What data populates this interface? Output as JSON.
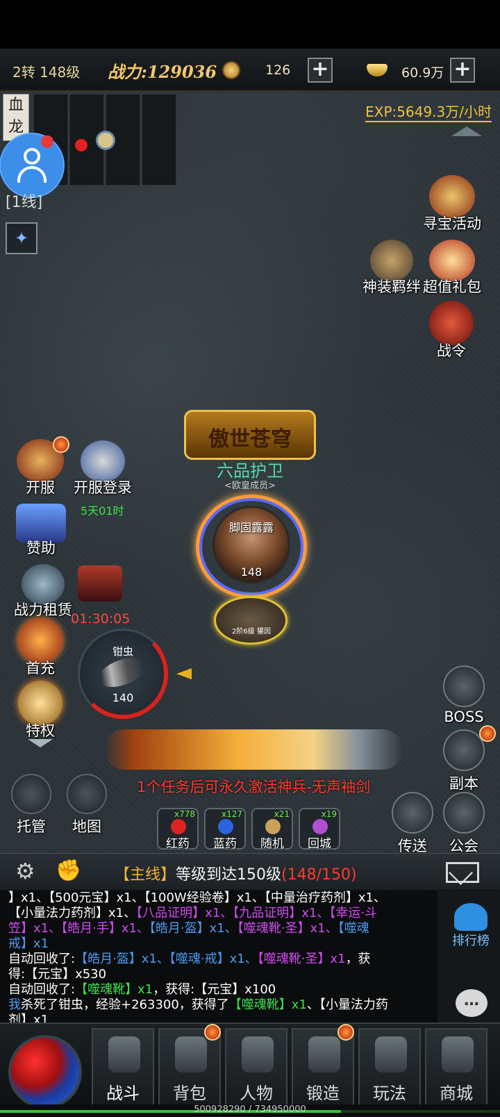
{
  "topbar": {
    "level": "2转 148级",
    "power": "战力:129036",
    "coins": "126",
    "ingots": "60.9万"
  },
  "exp_rate": "EXP:5649.3万/小时",
  "map": {
    "name": "血龙",
    "line": "[1线]"
  },
  "left_activities": [
    {
      "label": "开服"
    },
    {
      "label": "开服登录",
      "sub": "5天01时"
    },
    {
      "label": "赞助"
    },
    {
      "label": "战力租赁",
      "sub": "01:30:05"
    },
    {
      "label": "首充"
    },
    {
      "label": "特权"
    }
  ],
  "right_activities": [
    {
      "label": "寻宝活动"
    },
    {
      "label": "神装羁绊"
    },
    {
      "label": "超值礼包"
    },
    {
      "label": "战令"
    },
    {
      "label": "BOSS"
    },
    {
      "label": "副本"
    },
    {
      "label": "传送"
    },
    {
      "label": "公会"
    }
  ],
  "player": {
    "title": "傲世苍穹",
    "rank": "六品护卫",
    "guild": "<欧皇成员>",
    "name": "脚固露露",
    "level": "148",
    "pet_tag": "2阶6级 獾因"
  },
  "target": {
    "name": "钳虫",
    "level": "140",
    "hp_percent": 35
  },
  "quest_hint": {
    "prefix": "1个任务后可永久激活",
    "highlight": "神兵-无声袖剑"
  },
  "controls": {
    "auto": "托管",
    "map": "地图"
  },
  "potions": [
    {
      "label": "红药",
      "count": "x778",
      "color": "#d9241f"
    },
    {
      "label": "蓝药",
      "count": "x127",
      "color": "#2a64e0"
    },
    {
      "label": "随机",
      "count": "x21",
      "color": "#c9a15a"
    },
    {
      "label": "回城",
      "count": "x19",
      "color": "#b050d0"
    }
  ],
  "quest": {
    "tag": "【主线】",
    "text": "等级到达150级",
    "progress": "(148/150)"
  },
  "log": {
    "line1": "】x1、【500元宝】x1、【100W经验卷】x1、【中量治疗药剂】x1、",
    "line2_a": "【小量法力药剂】x1、",
    "line2_b": "【八品证明】x1、",
    "line2_c": "【九品证明】x1、",
    "line2_d": "【幸运·斗",
    "line3_a": "笠】x1、",
    "line3_b": "【皓月·手】x1、",
    "line3_c": "【皓月·盔】x1、",
    "line3_d": "【噬魂靴·圣】x1、",
    "line3_e": "【噬魂",
    "line4": "戒】x1",
    "line5_a": "自动回收了:",
    "line5_b": "【皓月·盔】x1、",
    "line5_c": "【噬魂·戒】x1、",
    "line5_d": "【噬魂靴·圣】x1",
    "line5_e": "，获",
    "line6": "得:【元宝】x530",
    "line7_a": "自动回收了:",
    "line7_b": "【噬魂靴】x1",
    "line7_c": "，获得:【元宝】x100",
    "line8_a": "我",
    "line8_b": "杀死了钳虫，经验+263300，获得了",
    "line8_c": "【噬魂靴】x1",
    "line8_d": "、【小量法力药",
    "line9": "剂】x1"
  },
  "rank_label": "排行榜",
  "nav": [
    "战斗",
    "背包",
    "人物",
    "锻造",
    "玩法",
    "商城"
  ],
  "exp_bar": {
    "text": "500928290 / 734950000",
    "fraction": 0.6816
  }
}
